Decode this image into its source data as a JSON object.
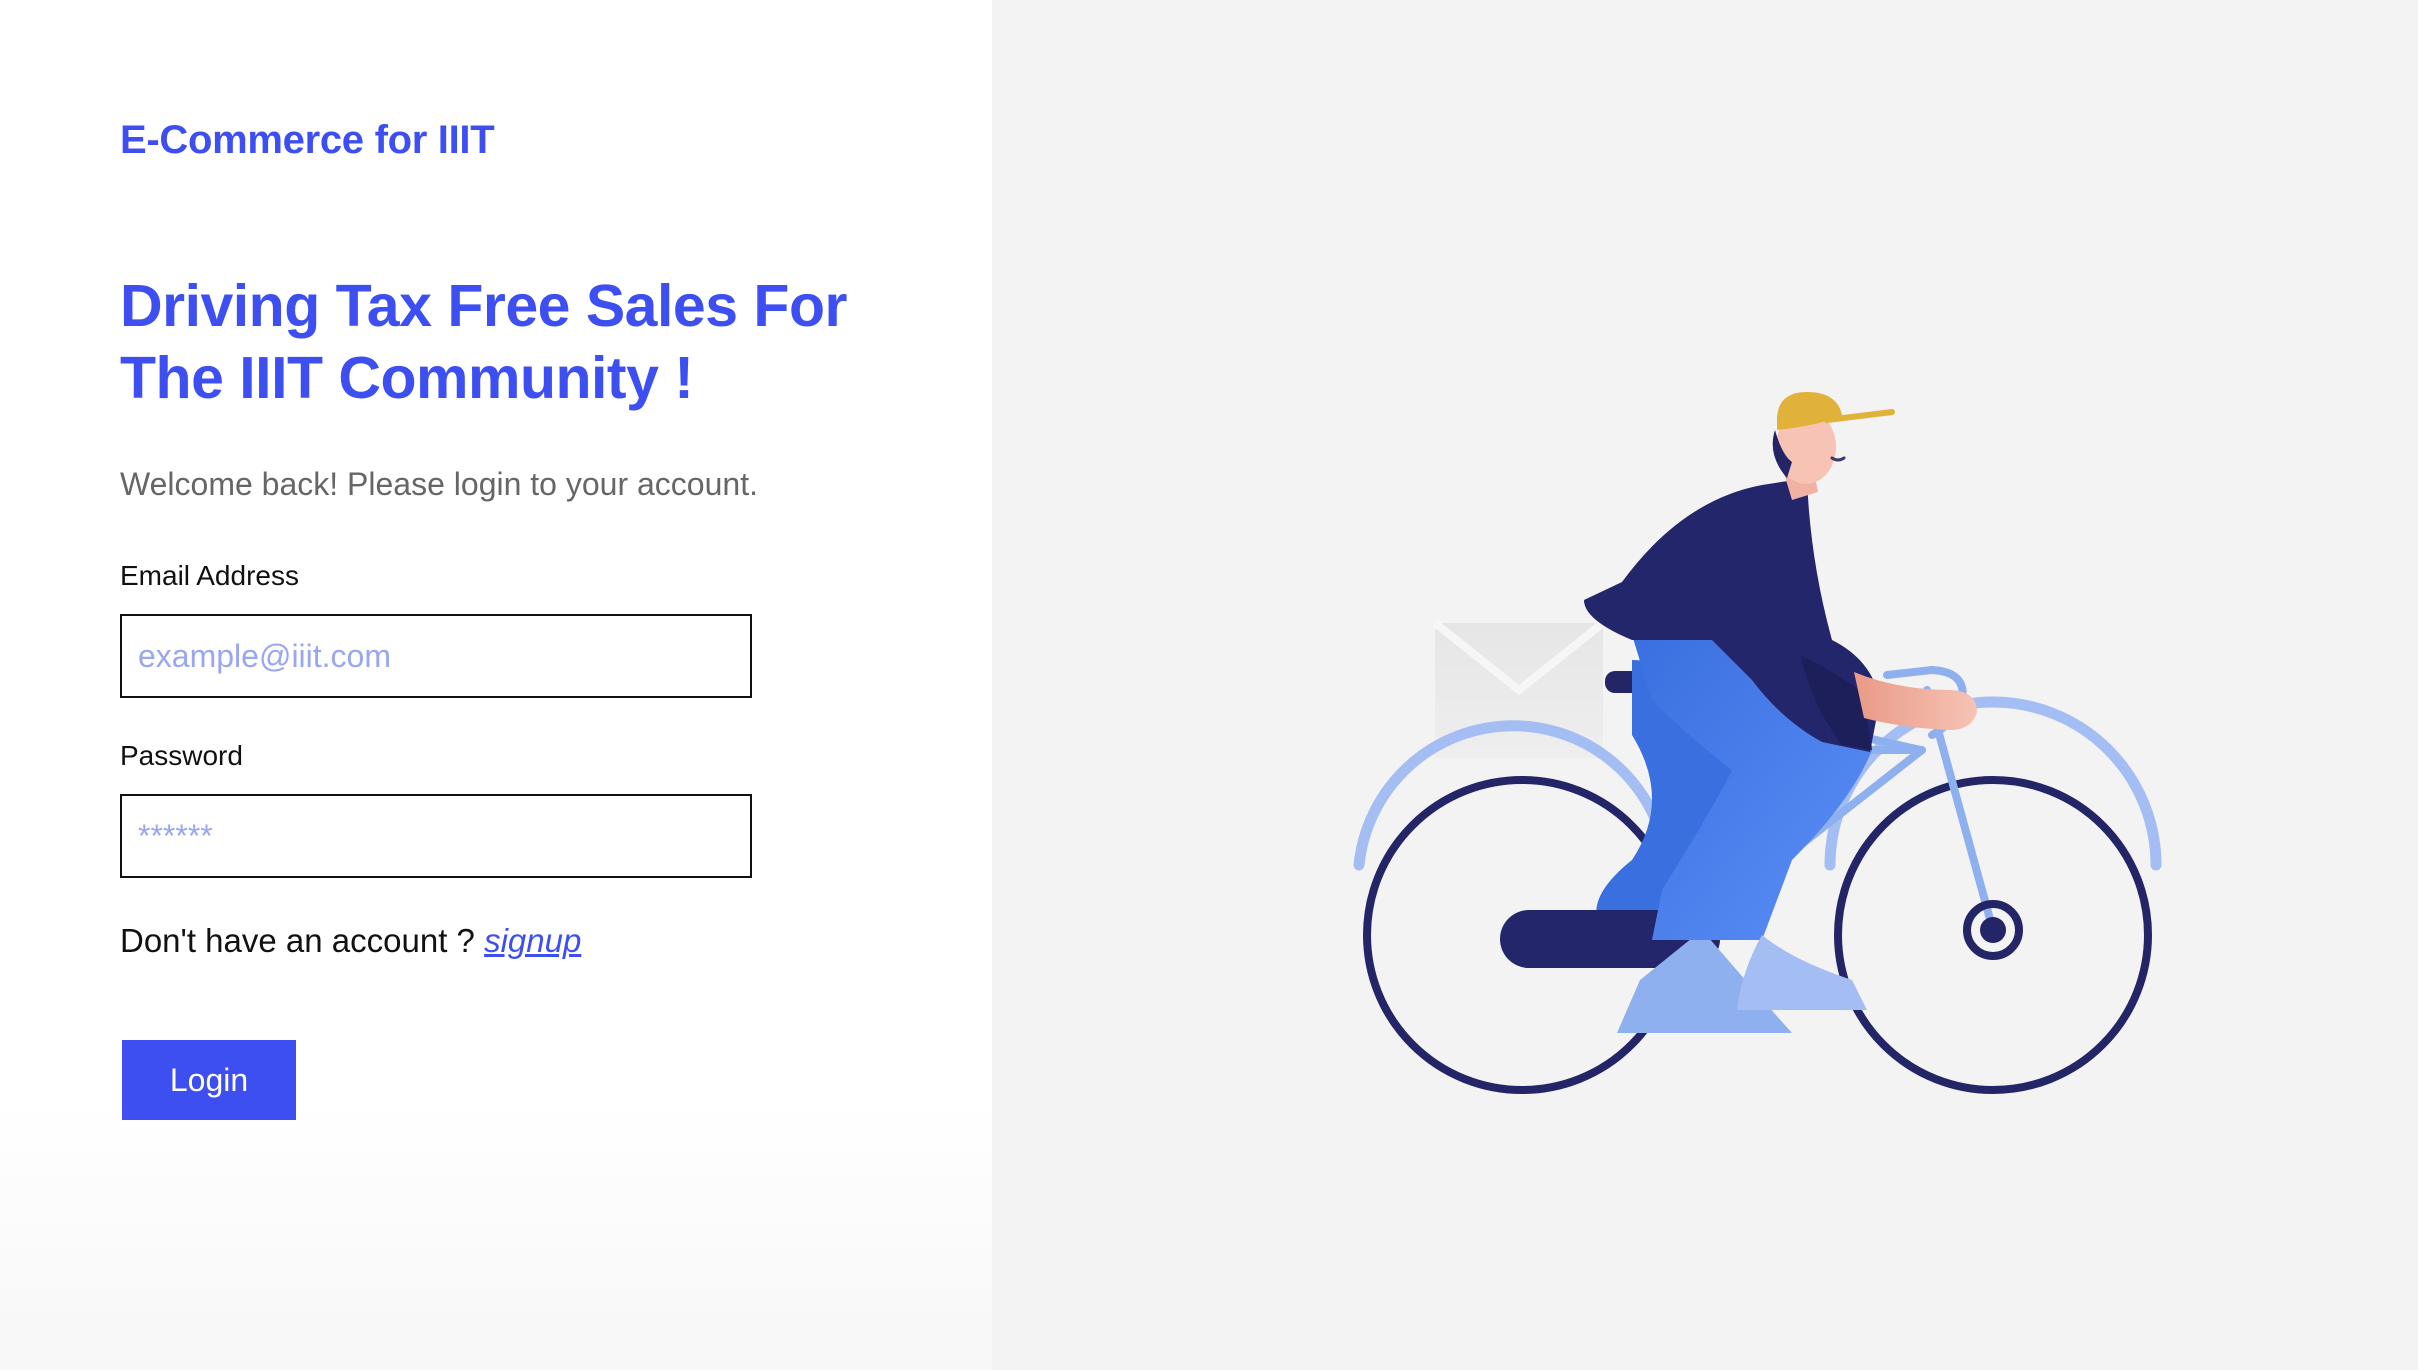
{
  "brand": {
    "name": "E-Commerce for IIIT"
  },
  "hero": {
    "headline_line1": "Driving Tax Free Sales For",
    "headline_line2": "The IIIT Community !",
    "subtitle": "Welcome back! Please login to your account."
  },
  "form": {
    "email": {
      "label": "Email Address",
      "placeholder": "example@iiit.com",
      "value": ""
    },
    "password": {
      "label": "Password",
      "placeholder": "******",
      "value": ""
    },
    "signup_prompt": "Don't have an account ?",
    "signup_link": "signup",
    "login_label": "Login"
  },
  "illustration": {
    "subject": "person-riding-bicycle"
  },
  "colors": {
    "accent": "#3d4ff0",
    "right_panel_bg": "#f3f3f3",
    "navy": "#232567",
    "light_blue": "#a4bef3",
    "mid_blue": "#5b8ef5",
    "cap_yellow": "#e0b23a"
  }
}
